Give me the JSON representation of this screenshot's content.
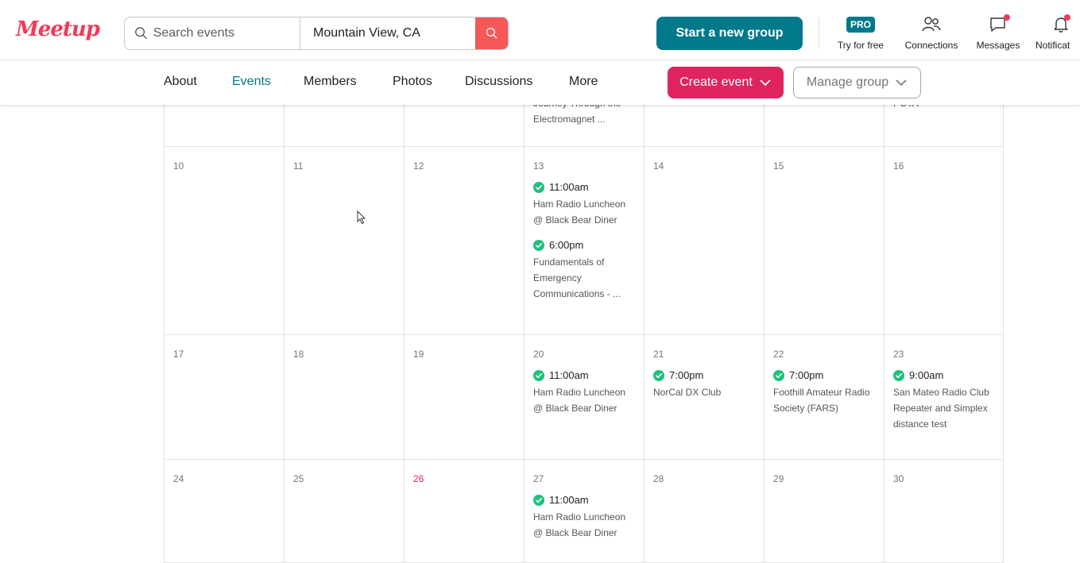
{
  "header": {
    "logo": "Meetup",
    "search_placeholder": "Search events",
    "location_value": "Mountain View, CA",
    "start_group_label": "Start a new group",
    "pro_badge": "PRO",
    "pro_label": "Try for free",
    "connections_label": "Connections",
    "messages_label": "Messages",
    "notifications_label": "Notificat"
  },
  "subnav": {
    "tabs": [
      "About",
      "Events",
      "Members",
      "Photos",
      "Discussions",
      "More"
    ],
    "active_tab": "Events",
    "create_event_label": "Create event",
    "manage_group_label": "Manage group"
  },
  "calendar": {
    "top_partial": {
      "col4_line1": "Journey Through the",
      "col4_line2": "Electromagnet ...",
      "col7_text": "POTA"
    },
    "weeks": [
      {
        "days": [
          {
            "num": "10",
            "events": []
          },
          {
            "num": "11",
            "events": []
          },
          {
            "num": "12",
            "events": []
          },
          {
            "num": "13",
            "events": [
              {
                "time": "11:00am",
                "title": "Ham Radio Luncheon @ Black Bear Diner"
              },
              {
                "time": "6:00pm",
                "title": "Fundamentals of Emergency Communications - ..."
              }
            ]
          },
          {
            "num": "14",
            "events": []
          },
          {
            "num": "15",
            "events": []
          },
          {
            "num": "16",
            "events": []
          }
        ]
      },
      {
        "days": [
          {
            "num": "17",
            "events": []
          },
          {
            "num": "18",
            "events": []
          },
          {
            "num": "19",
            "events": []
          },
          {
            "num": "20",
            "events": [
              {
                "time": "11:00am",
                "title": "Ham Radio Luncheon @ Black Bear Diner"
              }
            ]
          },
          {
            "num": "21",
            "events": [
              {
                "time": "7:00pm",
                "title": "NorCal DX Club"
              }
            ]
          },
          {
            "num": "22",
            "events": [
              {
                "time": "7:00pm",
                "title": "Foothill Amateur Radio Society (FARS)"
              }
            ]
          },
          {
            "num": "23",
            "events": [
              {
                "time": "9:00am",
                "title": "San Mateo Radio Club Repeater and Simplex distance test"
              }
            ]
          }
        ]
      },
      {
        "days": [
          {
            "num": "24",
            "events": []
          },
          {
            "num": "25",
            "events": []
          },
          {
            "num": "26",
            "today": true,
            "events": []
          },
          {
            "num": "27",
            "events": [
              {
                "time": "11:00am",
                "title": "Ham Radio Luncheon @ Black Bear Diner"
              }
            ]
          },
          {
            "num": "28",
            "events": []
          },
          {
            "num": "29",
            "events": []
          },
          {
            "num": "30",
            "events": []
          }
        ]
      }
    ]
  },
  "colors": {
    "brand": "#f13a59",
    "teal": "#00798a",
    "create_event": "#e0245e",
    "check": "#1ec17e",
    "today": "#e0245e"
  },
  "icons": [
    "search-icon",
    "people-icon",
    "chat-icon",
    "bell-icon",
    "chevron-down-icon",
    "check-circle-icon",
    "cursor-icon"
  ]
}
